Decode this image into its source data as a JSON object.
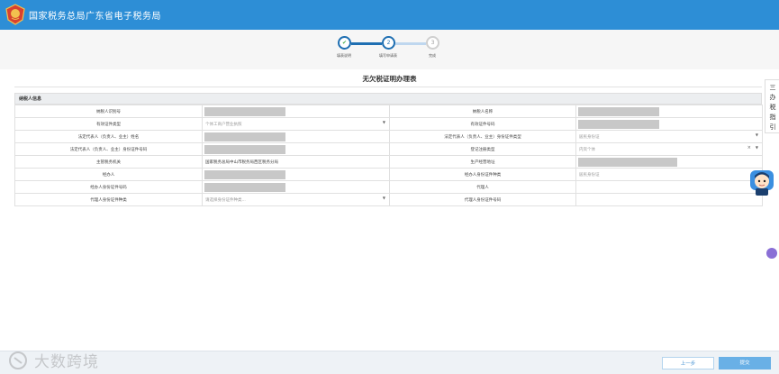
{
  "header": {
    "title": "国家税务总局广东省电子税务局"
  },
  "steps": [
    {
      "number": "✔",
      "label": "填表说明",
      "state": "done"
    },
    {
      "number": "2",
      "label": "填写申请表",
      "state": "active"
    },
    {
      "number": "3",
      "label": "完成",
      "state": "pending"
    }
  ],
  "form": {
    "title": "无欠税证明办理表",
    "section_title": "纳税人信息",
    "rows": [
      {
        "l1": "纳税人识别号",
        "v1": "",
        "l2": "纳税人名称",
        "v2": ""
      },
      {
        "l1": "有效证件类型",
        "v1": "个体工商户营业执照",
        "l2": "有效证件号码",
        "v2": ""
      },
      {
        "l1": "法定代表人（负责人、业主）姓名",
        "v1": "",
        "l2": "法定代表人（负责人、业主）身份证件类型",
        "v2": "居民身份证"
      },
      {
        "l1": "法定代表人（负责人、业主）身份证件号码",
        "v1": "",
        "l2": "登记注册类型",
        "v2": "内资个体"
      },
      {
        "l1": "主管税务机关",
        "v1": "国家税务总局中山市税务局西区税务分局",
        "l2": "生产经营地址",
        "v2": ""
      },
      {
        "l1": "经办人",
        "v1": "",
        "l2": "经办人身份证件种类",
        "v2": "居民身份证"
      },
      {
        "l1": "经办人身份证件号码",
        "v1": "",
        "l2": "代理人",
        "v2": ""
      },
      {
        "l1": "代理人身份证件种类",
        "v1": "请选择身份证件种类...",
        "l2": "代理人身份证件号码",
        "v2": ""
      }
    ]
  },
  "right_panel": {
    "chars": [
      "三",
      "办",
      "税",
      "指",
      "引"
    ]
  },
  "footer": {
    "prev_label": "上一步",
    "submit_label": "提交"
  },
  "watermark": {
    "text": "大数跨境"
  },
  "colors": {
    "header": "#2d8ed6",
    "accent": "#2d8ed6",
    "submit": "#69b0e6"
  }
}
